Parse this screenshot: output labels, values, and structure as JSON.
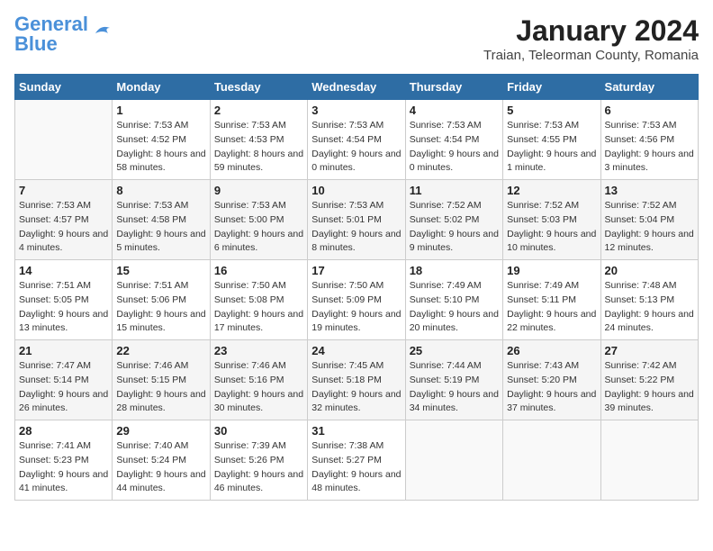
{
  "header": {
    "logo_line1": "General",
    "logo_line2": "Blue",
    "month_year": "January 2024",
    "location": "Traian, Teleorman County, Romania"
  },
  "days_of_week": [
    "Sunday",
    "Monday",
    "Tuesday",
    "Wednesday",
    "Thursday",
    "Friday",
    "Saturday"
  ],
  "weeks": [
    [
      {
        "num": "",
        "detail": ""
      },
      {
        "num": "1",
        "detail": "Sunrise: 7:53 AM\nSunset: 4:52 PM\nDaylight: 8 hours\nand 58 minutes."
      },
      {
        "num": "2",
        "detail": "Sunrise: 7:53 AM\nSunset: 4:53 PM\nDaylight: 8 hours\nand 59 minutes."
      },
      {
        "num": "3",
        "detail": "Sunrise: 7:53 AM\nSunset: 4:54 PM\nDaylight: 9 hours\nand 0 minutes."
      },
      {
        "num": "4",
        "detail": "Sunrise: 7:53 AM\nSunset: 4:54 PM\nDaylight: 9 hours\nand 0 minutes."
      },
      {
        "num": "5",
        "detail": "Sunrise: 7:53 AM\nSunset: 4:55 PM\nDaylight: 9 hours\nand 1 minute."
      },
      {
        "num": "6",
        "detail": "Sunrise: 7:53 AM\nSunset: 4:56 PM\nDaylight: 9 hours\nand 3 minutes."
      }
    ],
    [
      {
        "num": "7",
        "detail": "Sunrise: 7:53 AM\nSunset: 4:57 PM\nDaylight: 9 hours\nand 4 minutes."
      },
      {
        "num": "8",
        "detail": "Sunrise: 7:53 AM\nSunset: 4:58 PM\nDaylight: 9 hours\nand 5 minutes."
      },
      {
        "num": "9",
        "detail": "Sunrise: 7:53 AM\nSunset: 5:00 PM\nDaylight: 9 hours\nand 6 minutes."
      },
      {
        "num": "10",
        "detail": "Sunrise: 7:53 AM\nSunset: 5:01 PM\nDaylight: 9 hours\nand 8 minutes."
      },
      {
        "num": "11",
        "detail": "Sunrise: 7:52 AM\nSunset: 5:02 PM\nDaylight: 9 hours\nand 9 minutes."
      },
      {
        "num": "12",
        "detail": "Sunrise: 7:52 AM\nSunset: 5:03 PM\nDaylight: 9 hours\nand 10 minutes."
      },
      {
        "num": "13",
        "detail": "Sunrise: 7:52 AM\nSunset: 5:04 PM\nDaylight: 9 hours\nand 12 minutes."
      }
    ],
    [
      {
        "num": "14",
        "detail": "Sunrise: 7:51 AM\nSunset: 5:05 PM\nDaylight: 9 hours\nand 13 minutes."
      },
      {
        "num": "15",
        "detail": "Sunrise: 7:51 AM\nSunset: 5:06 PM\nDaylight: 9 hours\nand 15 minutes."
      },
      {
        "num": "16",
        "detail": "Sunrise: 7:50 AM\nSunset: 5:08 PM\nDaylight: 9 hours\nand 17 minutes."
      },
      {
        "num": "17",
        "detail": "Sunrise: 7:50 AM\nSunset: 5:09 PM\nDaylight: 9 hours\nand 19 minutes."
      },
      {
        "num": "18",
        "detail": "Sunrise: 7:49 AM\nSunset: 5:10 PM\nDaylight: 9 hours\nand 20 minutes."
      },
      {
        "num": "19",
        "detail": "Sunrise: 7:49 AM\nSunset: 5:11 PM\nDaylight: 9 hours\nand 22 minutes."
      },
      {
        "num": "20",
        "detail": "Sunrise: 7:48 AM\nSunset: 5:13 PM\nDaylight: 9 hours\nand 24 minutes."
      }
    ],
    [
      {
        "num": "21",
        "detail": "Sunrise: 7:47 AM\nSunset: 5:14 PM\nDaylight: 9 hours\nand 26 minutes."
      },
      {
        "num": "22",
        "detail": "Sunrise: 7:46 AM\nSunset: 5:15 PM\nDaylight: 9 hours\nand 28 minutes."
      },
      {
        "num": "23",
        "detail": "Sunrise: 7:46 AM\nSunset: 5:16 PM\nDaylight: 9 hours\nand 30 minutes."
      },
      {
        "num": "24",
        "detail": "Sunrise: 7:45 AM\nSunset: 5:18 PM\nDaylight: 9 hours\nand 32 minutes."
      },
      {
        "num": "25",
        "detail": "Sunrise: 7:44 AM\nSunset: 5:19 PM\nDaylight: 9 hours\nand 34 minutes."
      },
      {
        "num": "26",
        "detail": "Sunrise: 7:43 AM\nSunset: 5:20 PM\nDaylight: 9 hours\nand 37 minutes."
      },
      {
        "num": "27",
        "detail": "Sunrise: 7:42 AM\nSunset: 5:22 PM\nDaylight: 9 hours\nand 39 minutes."
      }
    ],
    [
      {
        "num": "28",
        "detail": "Sunrise: 7:41 AM\nSunset: 5:23 PM\nDaylight: 9 hours\nand 41 minutes."
      },
      {
        "num": "29",
        "detail": "Sunrise: 7:40 AM\nSunset: 5:24 PM\nDaylight: 9 hours\nand 44 minutes."
      },
      {
        "num": "30",
        "detail": "Sunrise: 7:39 AM\nSunset: 5:26 PM\nDaylight: 9 hours\nand 46 minutes."
      },
      {
        "num": "31",
        "detail": "Sunrise: 7:38 AM\nSunset: 5:27 PM\nDaylight: 9 hours\nand 48 minutes."
      },
      {
        "num": "",
        "detail": ""
      },
      {
        "num": "",
        "detail": ""
      },
      {
        "num": "",
        "detail": ""
      }
    ]
  ]
}
